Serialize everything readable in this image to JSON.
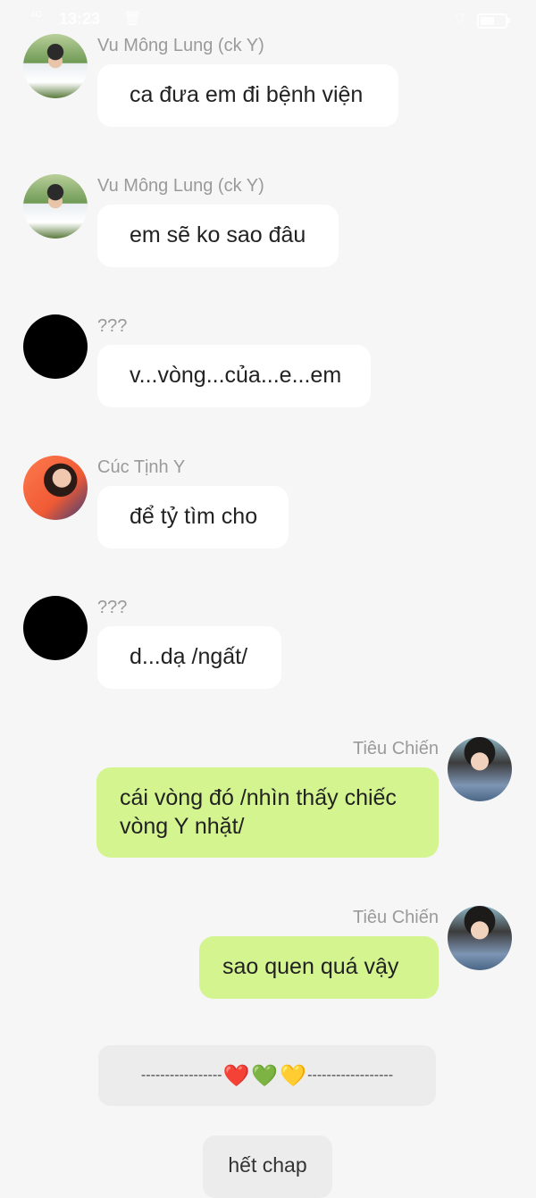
{
  "status_bar": {
    "time": "13:23",
    "network": "4G",
    "battery_percent": 60
  },
  "messages": [
    {
      "side": "left",
      "sender": "Vu Mông Lung (ck Y)",
      "text": "ca đưa em đi bệnh viện",
      "avatar": "photo-boy"
    },
    {
      "side": "left",
      "sender": "Vu Mông Lung (ck Y)",
      "text": "em sẽ ko sao đâu",
      "avatar": "photo-boy"
    },
    {
      "side": "left",
      "sender": "???",
      "text": "v...vòng...của...e...em",
      "avatar": "black-circle"
    },
    {
      "side": "left",
      "sender": "Cúc Tịnh Y",
      "text": "để tỷ tìm cho",
      "avatar": "photo-girl"
    },
    {
      "side": "left",
      "sender": "???",
      "text": "d...dạ /ngất/",
      "avatar": "black-circle"
    },
    {
      "side": "right",
      "sender": "Tiêu Chiến",
      "text": "cái vòng đó /nhìn thấy chiếc vòng Y nhặt/",
      "avatar": "photo-tieu"
    },
    {
      "side": "right",
      "sender": "Tiêu Chiến",
      "text": "sao quen quá vậy",
      "avatar": "photo-tieu"
    }
  ],
  "divider": {
    "left_dashes": "-----------------",
    "hearts": [
      "❤️",
      "💚",
      "💛"
    ],
    "right_dashes": "------------------"
  },
  "end_label": "hết chap",
  "colors": {
    "background": "#f6f6f6",
    "bubble_left": "#ffffff",
    "bubble_right": "#d4f490",
    "sender_text": "#9a9a9a"
  }
}
